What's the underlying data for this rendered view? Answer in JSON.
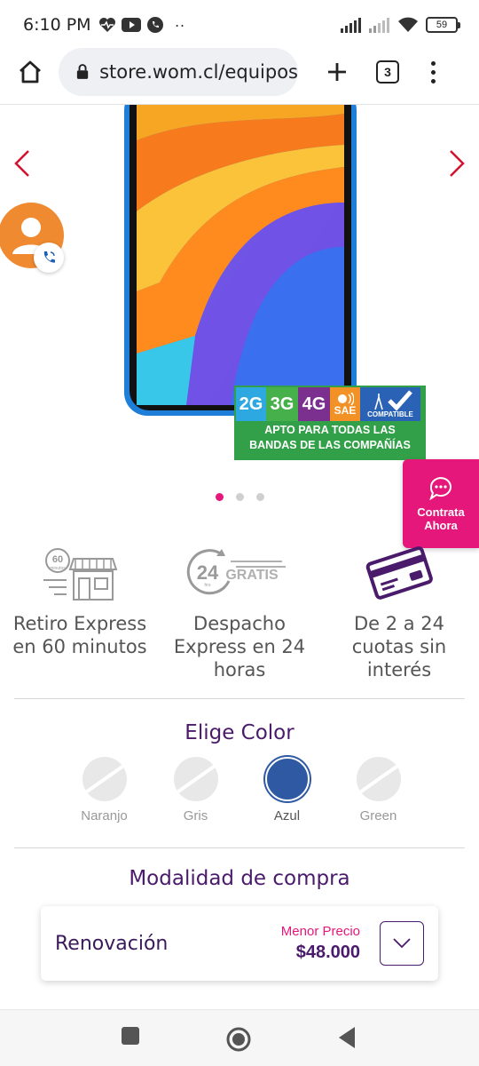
{
  "status_bar": {
    "time": "6:10 PM",
    "dots": "··",
    "battery": "59"
  },
  "browser": {
    "url": "store.wom.cl/equipos",
    "tab_count": "3"
  },
  "product": {
    "bands": [
      "2G",
      "3G",
      "4G",
      "SAE",
      "COMPATIBLE"
    ],
    "bands_caption_line1": "APTO PARA TODAS LAS",
    "bands_caption_line2": "BANDAS DE LAS COMPAÑÍAS",
    "carousel_pages": 3,
    "carousel_active": 0
  },
  "contrata": {
    "label": "Contrata Ahora"
  },
  "features": [
    {
      "icon": "store-express-icon",
      "badge": "60 minutos",
      "text": "Retiro Express en 60 minutos"
    },
    {
      "icon": "delivery-24-icon",
      "badge": "24 hrs GRATIS",
      "text": "Despacho Express en 24 horas"
    },
    {
      "icon": "credit-card-icon",
      "text": "De 2 a 24 cuotas sin interés"
    }
  ],
  "color_section": {
    "title": "Elige Color",
    "options": [
      {
        "name": "Naranjo",
        "available": false
      },
      {
        "name": "Gris",
        "available": false
      },
      {
        "name": "Azul",
        "available": true,
        "selected": true
      },
      {
        "name": "Green",
        "available": false
      }
    ]
  },
  "purchase_mode": {
    "title": "Modalidad de compra",
    "label": "Renovación",
    "tag": "Menor Precio",
    "price": "$48.000"
  },
  "colors": {
    "accent": "#e6177a",
    "brand": "#4a1a6b",
    "selected_color": "#2f5aa3",
    "avatar": "#f08a30"
  }
}
